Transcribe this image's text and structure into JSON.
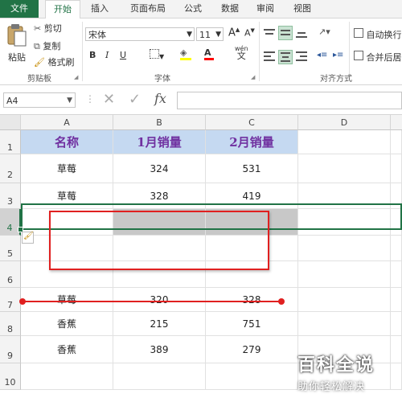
{
  "tabs": [
    "文件",
    "开始",
    "插入",
    "页面布局",
    "公式",
    "数据",
    "审阅",
    "视图"
  ],
  "clipboard": {
    "paste": "粘贴",
    "cut": "剪切",
    "copy": "复制",
    "format_painter": "格式刷",
    "label": "剪贴板"
  },
  "font": {
    "name": "宋体",
    "size": "11",
    "bold": "B",
    "italic": "I",
    "underline": "U",
    "label": "字体",
    "grow": "A",
    "shrink": "A",
    "phonetic": "wén",
    "color_letter": "A"
  },
  "alignment": {
    "wrap": "自动换行",
    "merge": "合并后居",
    "label": "对齐方式"
  },
  "formula_bar": {
    "name_box": "A4",
    "fx": "fx",
    "value": ""
  },
  "columns": [
    "A",
    "B",
    "C",
    "D"
  ],
  "rows": [
    {
      "num": "1",
      "cells": [
        "名称",
        "1月销量",
        "2月销量"
      ]
    },
    {
      "num": "2",
      "cells": [
        "草莓",
        "324",
        "531"
      ]
    },
    {
      "num": "3",
      "cells": [
        "草莓",
        "328",
        "419"
      ]
    },
    {
      "num": "4",
      "cells": [
        "",
        "",
        ""
      ]
    },
    {
      "num": "5",
      "cells": [
        "",
        "",
        ""
      ]
    },
    {
      "num": "6",
      "cells": [
        "",
        "",
        ""
      ]
    },
    {
      "num": "7",
      "cells": [
        "草莓",
        "320",
        "328"
      ]
    },
    {
      "num": "8",
      "cells": [
        "香蕉",
        "215",
        "751"
      ]
    },
    {
      "num": "9",
      "cells": [
        "香蕉",
        "389",
        "279"
      ]
    },
    {
      "num": "10",
      "cells": [
        "",
        "",
        ""
      ]
    }
  ],
  "watermark": {
    "title": "百科全说",
    "subtitle": "助你轻松解决"
  },
  "colors": {
    "excel_green": "#217346",
    "header_fill": "#c5d9f1",
    "header_text": "#7030a0",
    "annotation_red": "#e02020",
    "selected_row_fill": "#c8c8c8"
  }
}
